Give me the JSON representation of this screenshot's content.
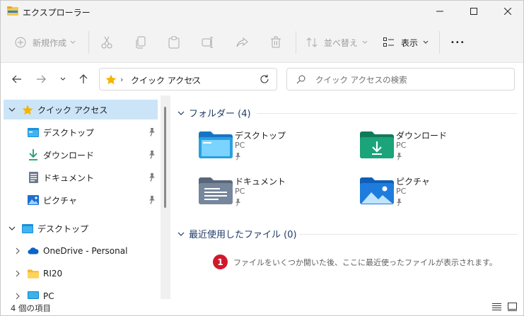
{
  "window": {
    "title": "エクスプローラー"
  },
  "toolbar": {
    "new_label": "新規作成",
    "sort_label": "並べ替え",
    "view_label": "表示",
    "more_label": "•••"
  },
  "address": {
    "location": "クイック アクセス"
  },
  "search": {
    "placeholder": "クイック アクセスの検索"
  },
  "sidebar": {
    "items": [
      {
        "label": "クイック アクセス",
        "icon": "star-icon"
      },
      {
        "label": "デスクトップ",
        "icon": "desktop-icon",
        "pinned": true
      },
      {
        "label": "ダウンロード",
        "icon": "download-icon",
        "pinned": true
      },
      {
        "label": "ドキュメント",
        "icon": "document-icon",
        "pinned": true
      },
      {
        "label": "ピクチャ",
        "icon": "picture-icon",
        "pinned": true
      },
      {
        "label": "デスクトップ",
        "icon": "desktop-icon"
      },
      {
        "label": "OneDrive - Personal",
        "icon": "cloud-icon"
      },
      {
        "label": "RI20",
        "icon": "folder-icon"
      },
      {
        "label": "PC",
        "icon": "pc-icon"
      }
    ]
  },
  "main": {
    "folders_header": "フォルダー (4)",
    "folders": [
      {
        "name": "デスクトップ",
        "location": "PC"
      },
      {
        "name": "ダウンロード",
        "location": "PC"
      },
      {
        "name": "ドキュメント",
        "location": "PC"
      },
      {
        "name": "ピクチャ",
        "location": "PC"
      }
    ],
    "recent_header": "最近使用したファイル (0)",
    "badge_number": "1",
    "empty_message": "ファイルをいくつか開いた後、ここに最近使ったファイルが表示されます。"
  },
  "status": {
    "item_count": "4 個の項目"
  },
  "colors": {
    "accent": "#0067c0",
    "selection": "#cce4f7",
    "section_header": "#1f3a68",
    "badge": "#d1192b"
  }
}
